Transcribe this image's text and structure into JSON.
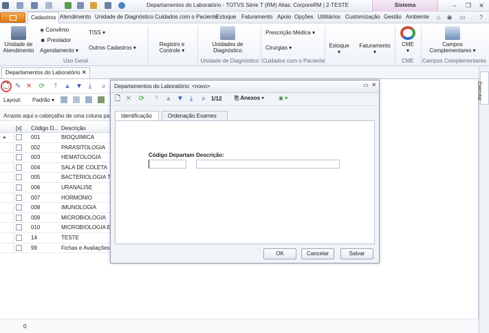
{
  "window": {
    "title": "Departamentos do Laboratório - TOTVS Série T  (RM)  Alias: CorporeRM | 2-TESTE",
    "context_tab": "Sistema"
  },
  "menu": {
    "items": [
      "Cadastros",
      "Atendimento",
      "Unidade de Diagnóstico",
      "Cuidados com o Paciente",
      "Estoque",
      "Faturamento",
      "Apoio",
      "Opções",
      "Utilitários",
      "Customização",
      "Gestão",
      "Ambiente"
    ],
    "active": "Cadastros"
  },
  "ribbon": {
    "unidade_atendimento": "Unidade de\nAtendimento",
    "convenio": "Convênio",
    "prestador": "Prestador",
    "agendamento": "Agendamento",
    "tiss": "TISS",
    "outros_cadastros": "Outros Cadastros",
    "group_uso_geral": "Uso Geral",
    "registro_controle": "Registro e\nControle",
    "unidades_diagnostico": "Unidades de\nDiagnóstico",
    "group_unidade_diagnostico": "Unidade de Diagnóstico",
    "prescricao_medica": "Prescrição Médica",
    "cirurgias": "Cirurgias",
    "group_cuidados": "Cuidados com o Paciente",
    "estoque": "Estoque",
    "faturamento": "Faturamento",
    "cme": "CME",
    "group_cme": "CME",
    "campos_complementares": "Campos\nComplementares",
    "group_campos": "Campos Complementares"
  },
  "doc_tab": {
    "label": "Departamentos do Laboratório"
  },
  "side_dock": {
    "executar": "Executar"
  },
  "list": {
    "layout_label": "Layout:",
    "layout_value": "Padrão",
    "group_hint": "Arraste aqui o cabeçalho de uma coluna para a",
    "columns": [
      "[x]",
      "Código D...",
      "Descrição"
    ],
    "rows": [
      {
        "code": "001",
        "desc": "BIOQUIMICA"
      },
      {
        "code": "002",
        "desc": "PARASITOLOGIA"
      },
      {
        "code": "003",
        "desc": "HEMATOLOGIA"
      },
      {
        "code": "004",
        "desc": "SALA DE COLETA"
      },
      {
        "code": "005",
        "desc": "BACTERIOLOGIA TESTE"
      },
      {
        "code": "006",
        "desc": "URANALISE"
      },
      {
        "code": "007",
        "desc": "HORMONIO"
      },
      {
        "code": "008",
        "desc": "IMUNOLOGIA"
      },
      {
        "code": "009",
        "desc": "MICROBIOLOGIA"
      },
      {
        "code": "010",
        "desc": "MICROBIOLOGIA E BI"
      },
      {
        "code": "14",
        "desc": "TESTE"
      },
      {
        "code": "99",
        "desc": "Fichas e Avaliações"
      }
    ],
    "footer_count": "0"
  },
  "dialog": {
    "title": "Departamentos do Laboratório: <novo>",
    "record_position": "1/12",
    "anexos": "Anexos",
    "tabs": [
      "Identificação",
      "Ordenação Exames"
    ],
    "active_tab": "Identificação",
    "fields": {
      "codigo_label": "Código Departam",
      "codigo_value": "",
      "descricao_label": "Descrição:",
      "descricao_value": ""
    },
    "buttons": {
      "ok": "OK",
      "cancel": "Cancelar",
      "save": "Salvar"
    }
  },
  "colors": {
    "app_button": "#e88a1e",
    "selection_ring": "#e0443f",
    "context_tab": "#e8d3ea"
  }
}
